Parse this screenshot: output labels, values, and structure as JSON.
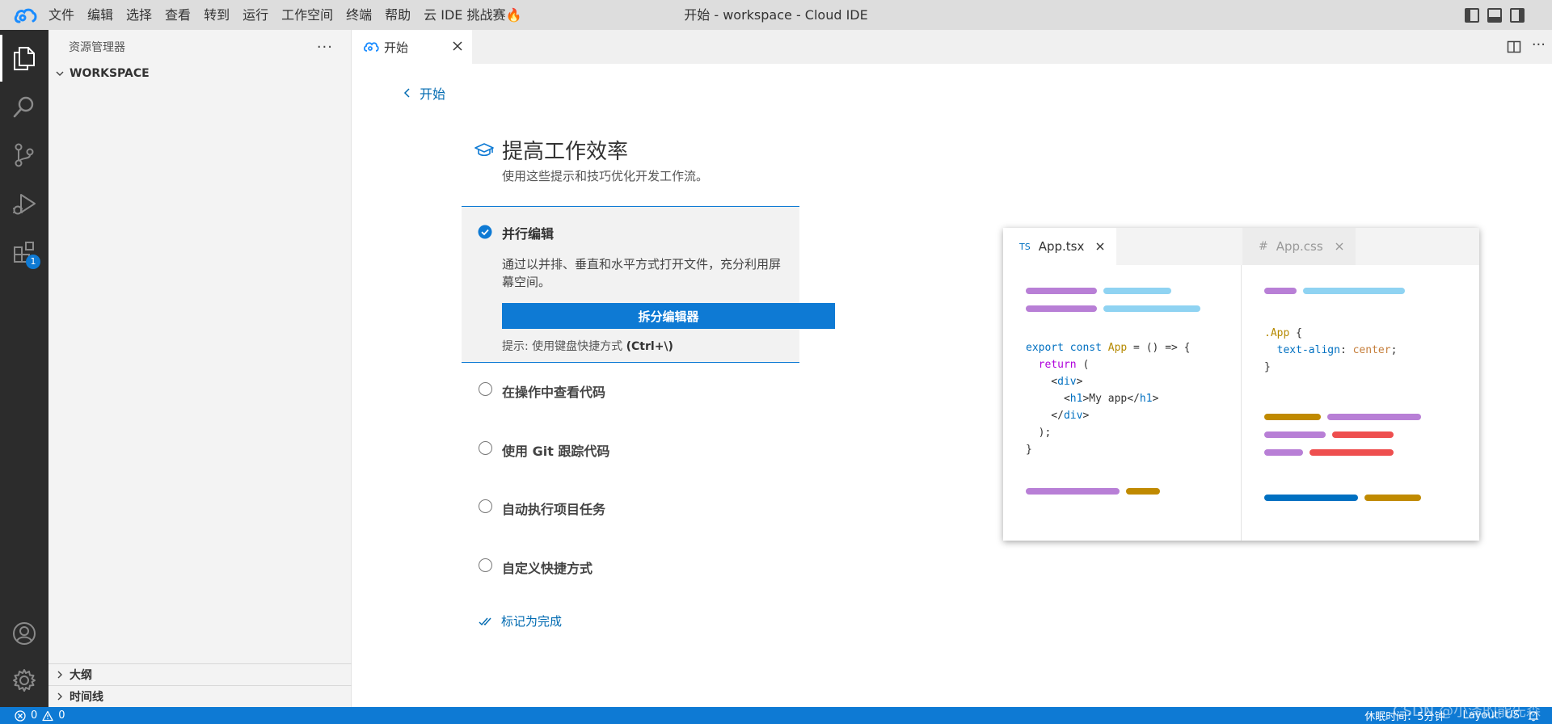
{
  "menu": {
    "items": [
      "文件",
      "编辑",
      "选择",
      "查看",
      "转到",
      "运行",
      "工作空间",
      "终端",
      "帮助",
      "云 IDE 挑战赛🔥"
    ],
    "window_title": "开始 - workspace - Cloud IDE"
  },
  "activity_bar": {
    "extensions_badge": "1"
  },
  "sidebar": {
    "title": "资源管理器",
    "more": "···",
    "workspace": "WORKSPACE",
    "outline": "大纲",
    "timeline": "时间线"
  },
  "tabs": {
    "welcome_label": "开始",
    "more": "···"
  },
  "welcome": {
    "back_label": "开始",
    "title": "提高工作效率",
    "subtitle": "使用这些提示和技巧优化开发工作流。",
    "active_step": {
      "title": "并行编辑",
      "description": "通过以并排、垂直和水平方式打开文件，充分利用屏幕空间。",
      "button": "拆分编辑器",
      "hint_prefix": "提示: 使用键盘快捷方式 ",
      "hint_keys": "(Ctrl+\\)"
    },
    "steps": [
      "在操作中查看代码",
      "使用 Git 跟踪代码",
      "自动执行项目任务",
      "自定义快捷方式"
    ],
    "mark_done": "标记为完成"
  },
  "preview": {
    "tab1": {
      "lang": "TS",
      "name": "App.tsx"
    },
    "tab2": {
      "lang": "#",
      "name": "App.css"
    },
    "code_left": {
      "l1_kw": "export const",
      "l1_fn": "App",
      "l1_rest": " = () => {",
      "l2": "return",
      "l2_rest": " (",
      "l3_open": "<",
      "l3_tag": "div",
      "l3_close": ">",
      "l4_tag1": "h1",
      "l4_text": "My app",
      "l4_tag2": "h1",
      "l5_tag": "div",
      "l6": ");",
      "l7": "}"
    },
    "code_right": {
      "selector": ".App",
      "brace_open": " {",
      "prop": "text-align",
      "value": "center",
      "brace_close": "}"
    }
  },
  "status": {
    "errors": "0",
    "warnings": "0",
    "sleep": "休眠时间：5分钟",
    "layout": "Layout: US"
  },
  "watermark": "CSDN @小泽的能先森"
}
